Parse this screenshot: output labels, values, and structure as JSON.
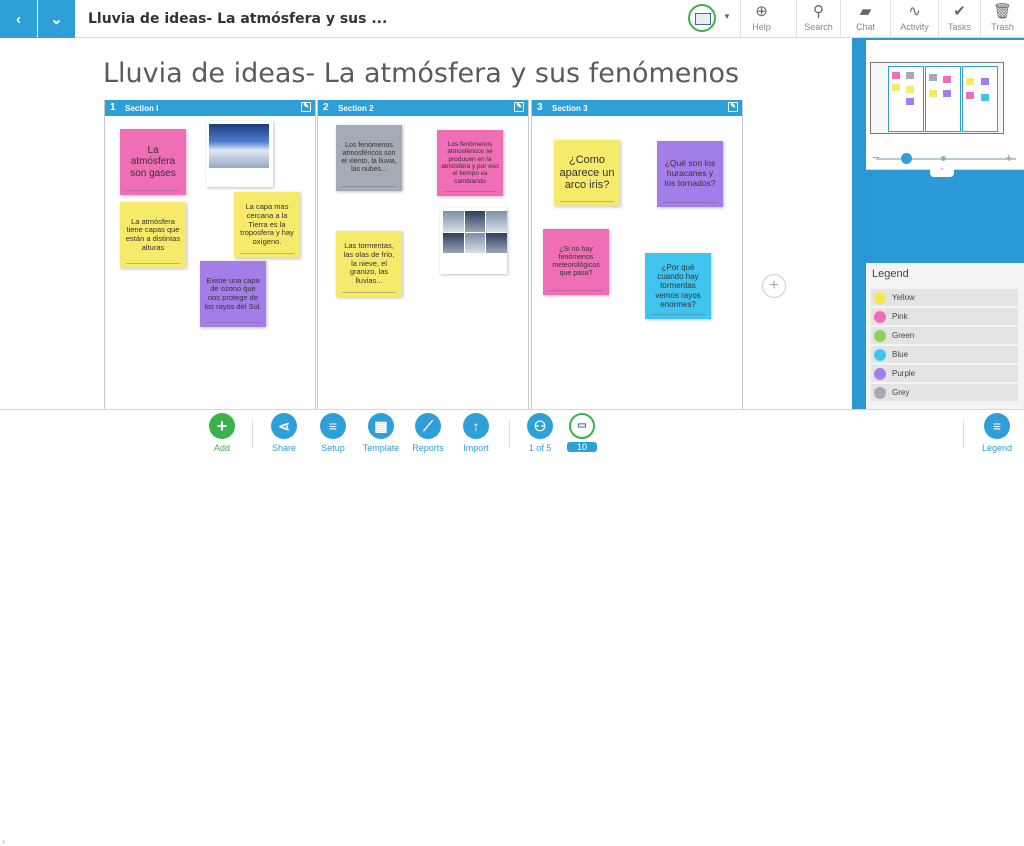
{
  "topbar": {
    "back_icon": "chevron-left-icon",
    "menu_icon": "chevron-down-icon",
    "board_name": "Lluvia de ideas- La atmósfera y sus ...",
    "tools": [
      {
        "icon": "help-icon",
        "label": "Help"
      },
      {
        "icon": "search-icon",
        "label": "Search"
      },
      {
        "icon": "chat-icon",
        "label": "Chat"
      },
      {
        "icon": "activity-icon",
        "label": "Activity"
      },
      {
        "icon": "tasks-icon",
        "label": "Tasks"
      },
      {
        "icon": "trash-icon",
        "label": "Trash"
      }
    ]
  },
  "board": {
    "title": "Lluvia de ideas- La atmósfera y sus fenómenos",
    "sections": [
      {
        "number": "1",
        "title": "Section I"
      },
      {
        "number": "2",
        "title": "Section 2"
      },
      {
        "number": "3",
        "title": "Section 3"
      }
    ],
    "notes": [
      {
        "color": "pink",
        "text": "La atmósfera son gases"
      },
      {
        "color": "yellow",
        "text": "La atmósfera tiene capas que están a distintas alturas"
      },
      {
        "color": "yellow",
        "text": "La capa mas cercana a la Tierra es la troposfera y hay oxígeno."
      },
      {
        "color": "purple",
        "text": "Existe una capa de ozono que nos protege de los rayos del Sol."
      },
      {
        "color": "grey",
        "text": "Los fenómenos atmosféricos son el viento, la lluvia, las nubes..."
      },
      {
        "color": "pink",
        "text": "Los fenómenos atmosféricos se producen en la atmósfera y por eso el tiempo va cambiando"
      },
      {
        "color": "yellow",
        "text": "Las tormentas, las olas de frío, la nieve, el granizo, las lluvias..."
      },
      {
        "color": "yellow",
        "text": "¿Como aparece un arco iris?"
      },
      {
        "color": "purple",
        "text": "¿Qué son los huracanes y los tornados?"
      },
      {
        "color": "pink",
        "text": "¿Si no hay fenómenos meteorológicos que pasa?"
      },
      {
        "color": "blue",
        "text": "¿Por qué cuando hay tormentas vemos rayos enormes?"
      }
    ],
    "add_section": "+"
  },
  "legend": {
    "title": "Legend",
    "items": [
      {
        "label": "Yellow",
        "color": "#f6e84c"
      },
      {
        "label": "Pink",
        "color": "#ef6eb5"
      },
      {
        "label": "Green",
        "color": "#8fce5a"
      },
      {
        "label": "Blue",
        "color": "#3ec4ef"
      },
      {
        "label": "Purple",
        "color": "#a47ee8"
      },
      {
        "label": "Grey",
        "color": "#a4abb4"
      }
    ]
  },
  "bottombar": {
    "buttons": [
      {
        "icon": "plus-icon",
        "label": "Add",
        "color": "#3bb24e"
      },
      {
        "icon": "share-icon",
        "label": "Share"
      },
      {
        "icon": "setup-icon",
        "label": "Setup"
      },
      {
        "icon": "template-icon",
        "label": "Template"
      },
      {
        "icon": "reports-icon",
        "label": "Reports"
      },
      {
        "icon": "import-icon",
        "label": "Import"
      },
      {
        "icon": "user-icon",
        "label": "1 of 5"
      },
      {
        "icon": "views-icon",
        "label": "10"
      },
      {
        "icon": "legend-icon",
        "label": "Legend"
      }
    ]
  }
}
